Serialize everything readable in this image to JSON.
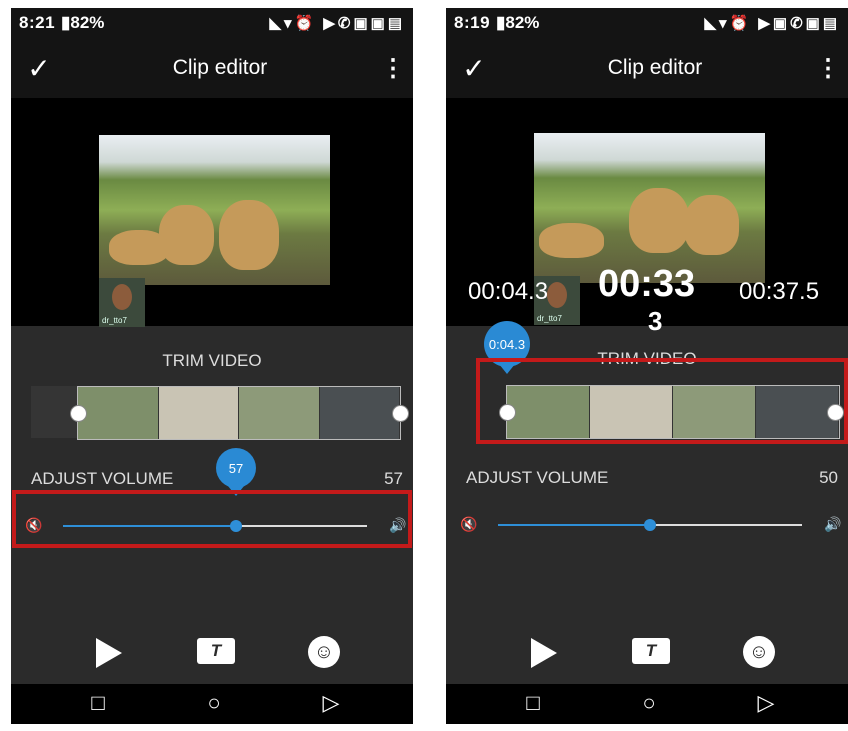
{
  "screens": [
    {
      "status": {
        "time": "8:21",
        "battery": "82%",
        "icons": "◣▾⏰  ▶✆▣▣▤"
      },
      "toolbar": {
        "check_icon": "✓",
        "title": "Clip editor",
        "more_icon": "⋮"
      },
      "thumbnail_handle": "dr_tto7",
      "trim_label": "TRIM VIDEO",
      "volume": {
        "label": "ADJUST VOLUME",
        "value": "57",
        "bubble": "57",
        "level": 0.57
      },
      "controls": {
        "text_icon": "T",
        "emoji_icon": "☺"
      },
      "nav": {
        "recent": "□",
        "home": "○",
        "back": "▷"
      }
    },
    {
      "status": {
        "time": "8:19",
        "battery": "82%",
        "icons": "◣▾⏰  ▶▣✆▣▤"
      },
      "toolbar": {
        "check_icon": "✓",
        "title": "Clip editor",
        "more_icon": "⋮"
      },
      "thumbnail_handle": "dr_tto7",
      "timer": {
        "start": "00:04.3",
        "center": "00:33",
        "end": "00:37.5",
        "extra": "3"
      },
      "trim_label": "TRIM VIDEO",
      "trim_bubble": "0:04.3",
      "volume": {
        "label": "ADJUST VOLUME",
        "value": "50",
        "level": 0.5
      },
      "controls": {
        "text_icon": "T",
        "emoji_icon": "☺"
      },
      "nav": {
        "recent": "□",
        "home": "○",
        "back": "▷"
      }
    }
  ],
  "colors": {
    "accent": "#2e8fd8",
    "highlight": "#c41a1a",
    "background": "#2b2b2b"
  }
}
